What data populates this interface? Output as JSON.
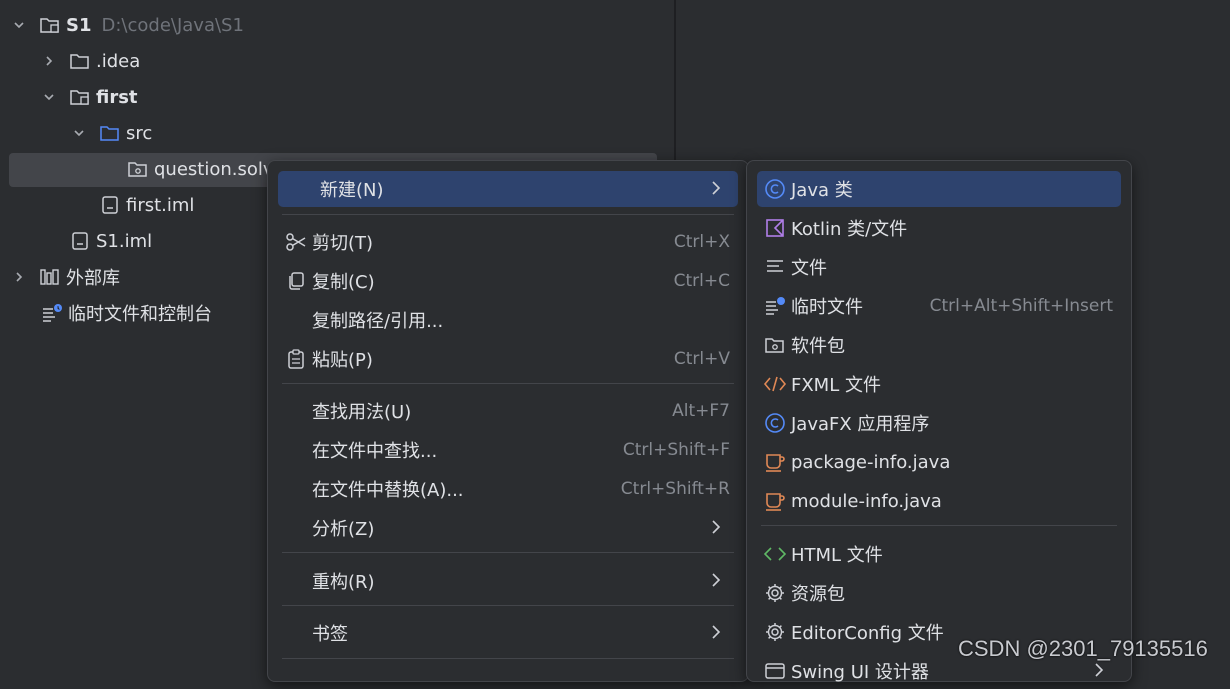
{
  "tree": {
    "root": {
      "name": "S1",
      "path": "D:\\code\\Java\\S1"
    },
    "idea": ".idea",
    "first": "first",
    "src": "src",
    "package": "question.solv",
    "first_iml": "first.iml",
    "s1_iml": "S1.iml",
    "external_libs": "外部库",
    "scratches": "临时文件和控制台"
  },
  "menu1": {
    "new": "新建(N)",
    "cut": {
      "label": "剪切(T)",
      "shortcut": "Ctrl+X"
    },
    "copy": {
      "label": "复制(C)",
      "shortcut": "Ctrl+C"
    },
    "copy_path": "复制路径/引用...",
    "paste": {
      "label": "粘贴(P)",
      "shortcut": "Ctrl+V"
    },
    "find_usages": {
      "label": "查找用法(U)",
      "shortcut": "Alt+F7"
    },
    "find_in_files": {
      "label": "在文件中查找...",
      "shortcut": "Ctrl+Shift+F"
    },
    "replace_in_files": {
      "label": "在文件中替换(A)...",
      "shortcut": "Ctrl+Shift+R"
    },
    "analyze": "分析(Z)",
    "refactor": "重构(R)",
    "bookmarks": "书签"
  },
  "menu2": {
    "java_class": "Java 类",
    "kotlin": "Kotlin 类/文件",
    "file": "文件",
    "scratch": {
      "label": "临时文件",
      "shortcut": "Ctrl+Alt+Shift+Insert"
    },
    "package": "软件包",
    "fxml": "FXML 文件",
    "javafx": "JavaFX 应用程序",
    "package_info": "package-info.java",
    "module_info": "module-info.java",
    "html": "HTML 文件",
    "resource_bundle": "资源包",
    "editorconfig": "EditorConfig 文件",
    "swing": "Swing UI 设计器"
  },
  "watermark": "CSDN @2301_79135516",
  "colors": {
    "accent": "#2e436e",
    "background": "#2b2d30",
    "java_blue": "#548af7",
    "kotlin_purple": "#b07ee8",
    "orange": "#e08855",
    "green": "#5fb865"
  }
}
